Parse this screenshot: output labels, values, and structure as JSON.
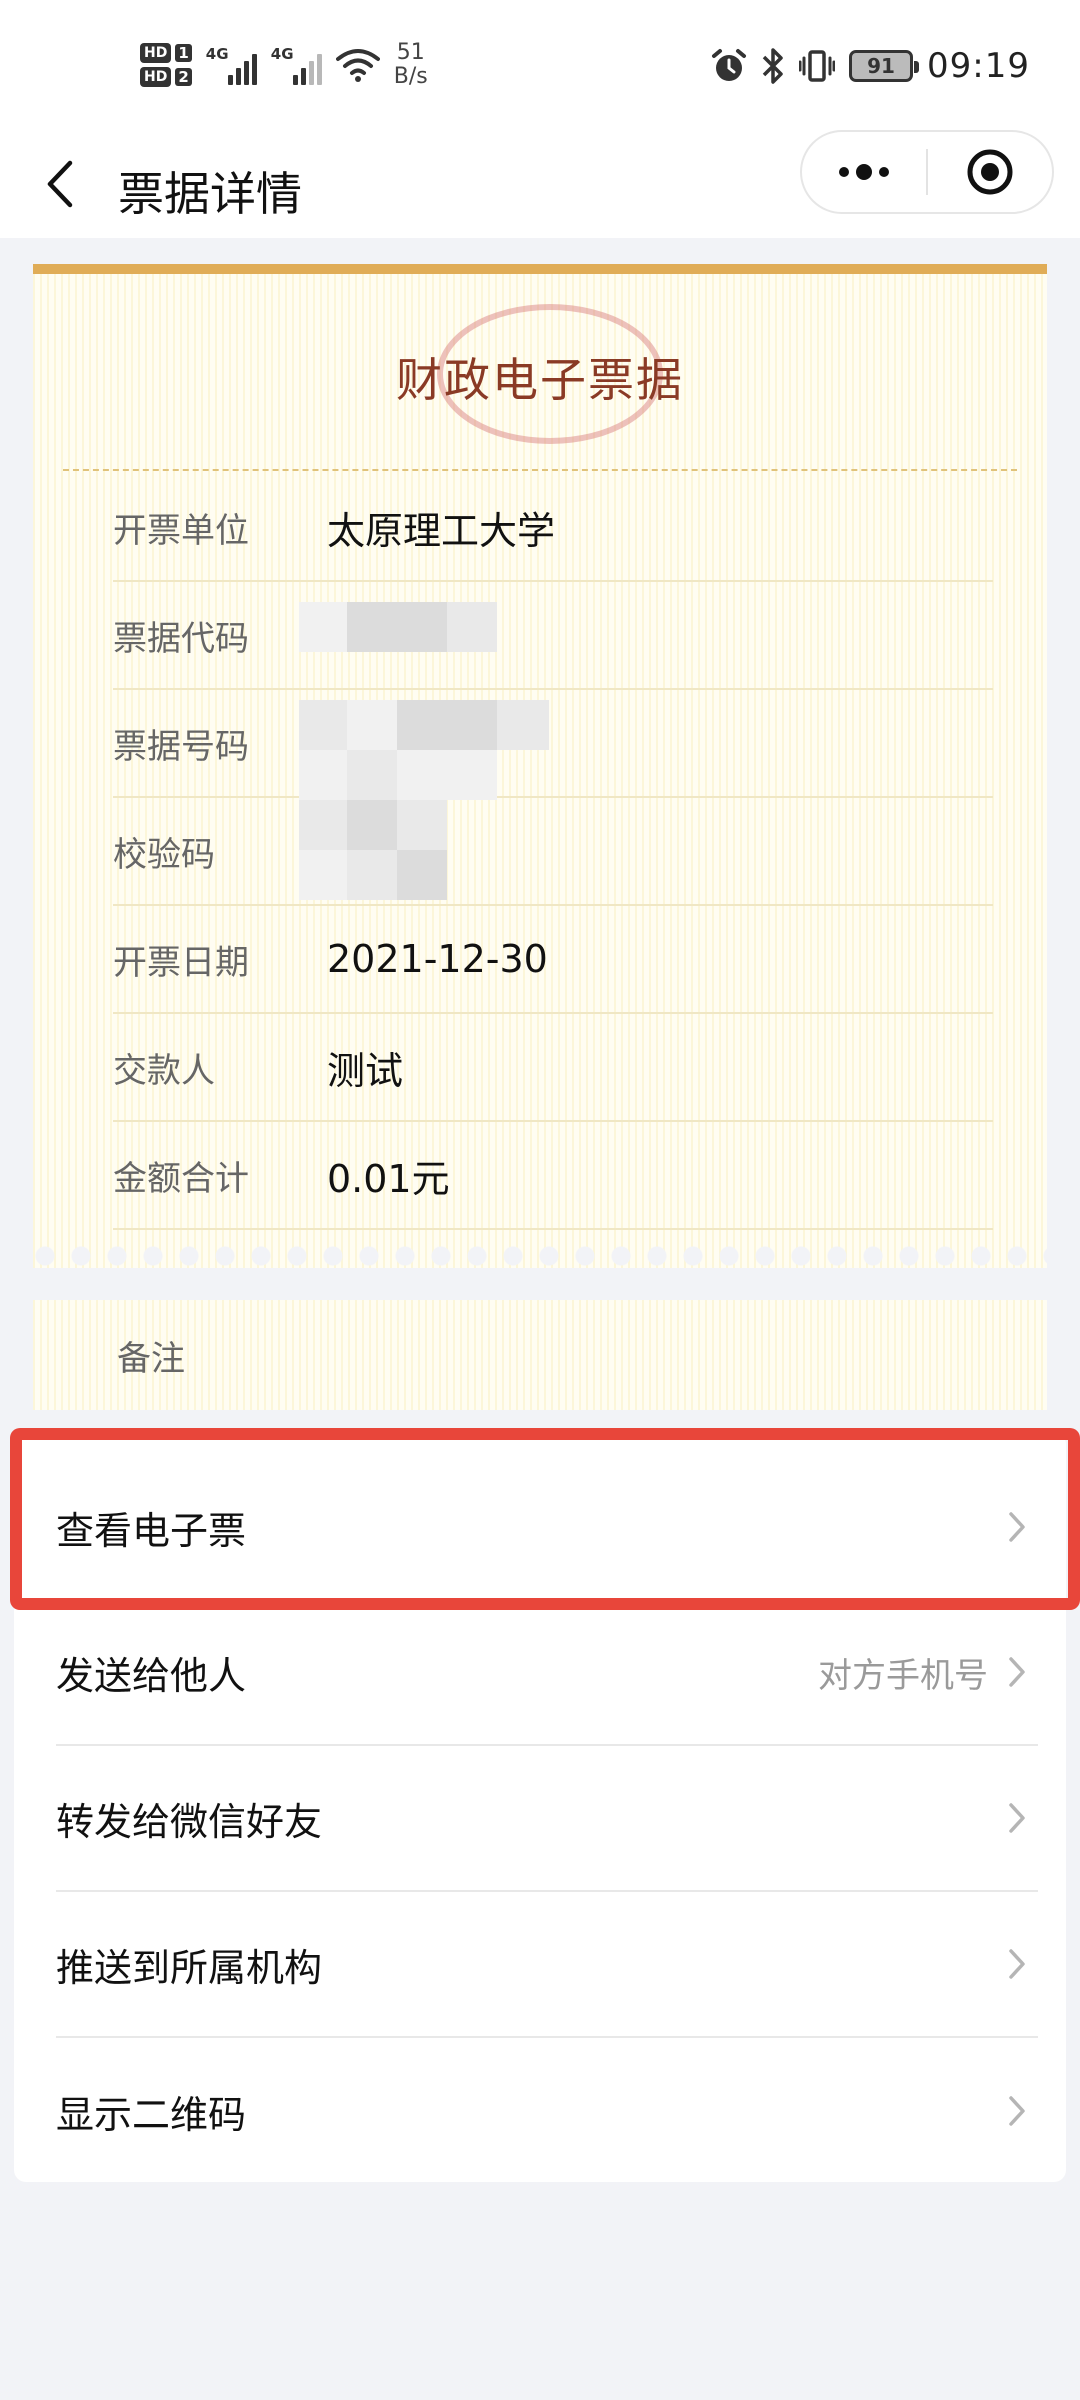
{
  "status_bar": {
    "sim1": "HD",
    "sim1_num": "1",
    "sim2": "HD",
    "sim2_num": "2",
    "network1": "4G",
    "network2": "4G",
    "speed_value": "51",
    "speed_unit": "B/s",
    "battery": "91",
    "time": "09:19",
    "icons": [
      "alarm-icon",
      "bluetooth-icon",
      "vibrate-icon",
      "battery-icon"
    ]
  },
  "nav": {
    "title": "票据详情",
    "back_icon": "chevron-left-icon",
    "more_icon": "more-dots-icon",
    "close_icon": "target-circle-icon"
  },
  "receipt": {
    "title": "财政电子票据",
    "fields": [
      {
        "label": "开票单位",
        "value": "太原理工大学"
      },
      {
        "label": "票据代码",
        "value": ""
      },
      {
        "label": "票据号码",
        "value": ""
      },
      {
        "label": "校验码",
        "value": ""
      },
      {
        "label": "开票日期",
        "value": "2021-12-30"
      },
      {
        "label": "交款人",
        "value": "测试"
      },
      {
        "label": "金额合计",
        "value": "0.01元"
      }
    ],
    "remark_label": "备注"
  },
  "actions": [
    {
      "label": "查看电子票",
      "sub": ""
    },
    {
      "label": "发送给他人",
      "sub": "对方手机号"
    },
    {
      "label": "转发给微信好友",
      "sub": ""
    },
    {
      "label": "推送到所属机构",
      "sub": ""
    },
    {
      "label": "显示二维码",
      "sub": ""
    }
  ],
  "colors": {
    "receipt_top_line": "#e0ac57",
    "receipt_title": "#8a3a25",
    "highlight_border": "#e8463a",
    "page_bg": "#f2f3f7"
  }
}
